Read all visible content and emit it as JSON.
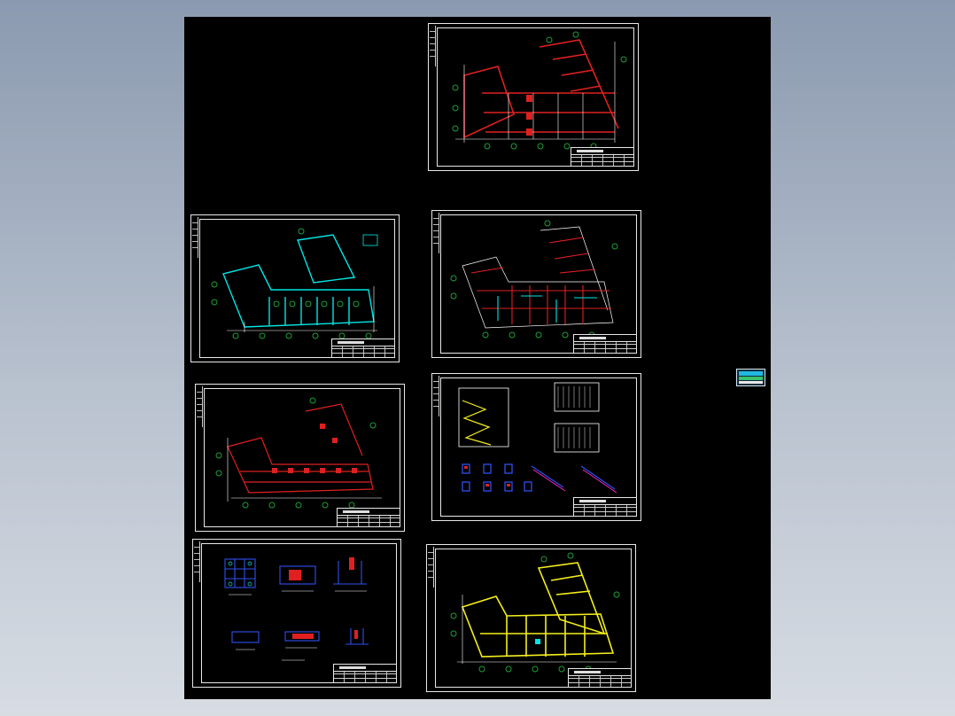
{
  "app": {
    "name": "",
    "background_top": "#8b9ab0",
    "background_bottom": "#d7dce3"
  },
  "colors": {
    "canvas": "#000000",
    "sheet_border": "#e8e8e8",
    "axis_grid": "#ffffff",
    "axis_bubble": "#1f9e34",
    "red_member": "#e02020",
    "cyan_member": "#00e5e5",
    "yellow_member": "#f5ef1b",
    "blue_detail": "#2f4ff0",
    "magenta_detail": "#ff2bd0"
  },
  "sheets": [
    {
      "id": "sheet-1",
      "drawing": "plan",
      "member_color": "red_member"
    },
    {
      "id": "sheet-2",
      "drawing": "plan",
      "member_color": "cyan_member"
    },
    {
      "id": "sheet-3",
      "drawing": "plan",
      "member_color": "red_member"
    },
    {
      "id": "sheet-4",
      "drawing": "plan",
      "member_color": "red_member"
    },
    {
      "id": "sheet-5",
      "drawing": "stair-details",
      "member_color": "yellow_member"
    },
    {
      "id": "sheet-6",
      "drawing": "foundation-details",
      "member_color": "blue_detail"
    },
    {
      "id": "sheet-7",
      "drawing": "plan",
      "member_color": "yellow_member"
    }
  ],
  "legend_icon": "layer-legend-icon"
}
